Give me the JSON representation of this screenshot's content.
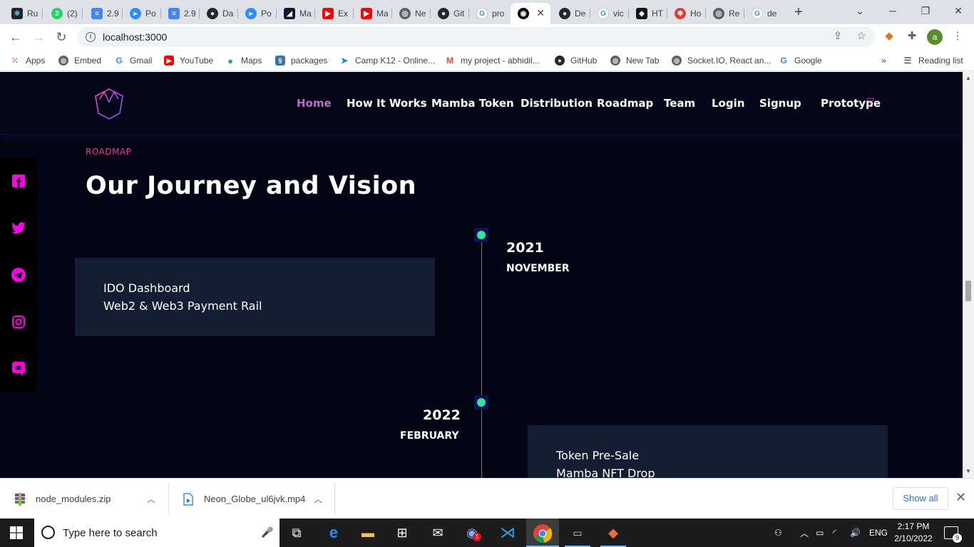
{
  "browser": {
    "tabs": [
      {
        "label": "Ru",
        "icon": "react-icon",
        "color": "#20232a"
      },
      {
        "label": "(2)",
        "icon": "whatsapp-icon",
        "color": "#25d366"
      },
      {
        "label": "2.9",
        "icon": "google-docs-icon",
        "color": "#4285f4"
      },
      {
        "label": "Po",
        "icon": "zoom-icon",
        "color": "#2d8cff"
      },
      {
        "label": "2.9",
        "icon": "google-docs-icon",
        "color": "#4285f4"
      },
      {
        "label": "Da",
        "icon": "github-icon",
        "color": "#24292e"
      },
      {
        "label": "Po",
        "icon": "zoom-icon",
        "color": "#2d8cff"
      },
      {
        "label": "Ma",
        "icon": "app-icon",
        "color": "#0b1a33"
      },
      {
        "label": "Ex",
        "icon": "youtube-icon",
        "color": "#ff0000"
      },
      {
        "label": "Ma",
        "icon": "youtube-icon",
        "color": "#ff0000"
      },
      {
        "label": "Ne",
        "icon": "web-icon",
        "color": "#5f6368"
      },
      {
        "label": "Git",
        "icon": "github-icon",
        "color": "#24292e"
      },
      {
        "label": "pro",
        "icon": "google-icon",
        "color": "#4285f4"
      },
      {
        "label": "",
        "icon": "site-icon",
        "color": "#000000",
        "active": true
      },
      {
        "label": "De",
        "icon": "github-icon",
        "color": "#24292e"
      },
      {
        "label": "vic",
        "icon": "google-icon",
        "color": "#4285f4"
      },
      {
        "label": "HT",
        "icon": "codesandbox-icon",
        "color": "#151515"
      },
      {
        "label": "Ho",
        "icon": "gear-red-icon",
        "color": "#e53935"
      },
      {
        "label": "Re",
        "icon": "web-icon",
        "color": "#5f6368"
      },
      {
        "label": "de",
        "icon": "google-icon",
        "color": "#4285f4"
      }
    ],
    "url": "localhost:3000",
    "profile_initial": "a"
  },
  "bookmarks": [
    {
      "label": "Apps",
      "icon": "apps-grid-icon",
      "color": "#ea4335"
    },
    {
      "label": "Embed",
      "icon": "web-icon",
      "color": "#5f6368"
    },
    {
      "label": "Gmail",
      "icon": "google-icon",
      "color": "#4285f4"
    },
    {
      "label": "YouTube",
      "icon": "youtube-icon",
      "color": "#ff0000"
    },
    {
      "label": "Maps",
      "icon": "maps-pin-icon",
      "color": "#34a853"
    },
    {
      "label": "packages",
      "icon": "python-icon",
      "color": "#3776ab"
    },
    {
      "label": "Camp K12 - Online...",
      "icon": "campk12-icon",
      "color": "#1e88e5"
    },
    {
      "label": "my project - abhidil...",
      "icon": "gmail-icon",
      "color": "#ea4335"
    },
    {
      "label": "GitHub",
      "icon": "github-icon",
      "color": "#24292e"
    },
    {
      "label": "New Tab",
      "icon": "web-icon",
      "color": "#5f6368"
    },
    {
      "label": "Socket.IO, React an...",
      "icon": "web-icon",
      "color": "#5f6368"
    },
    {
      "label": "Google",
      "icon": "google-icon",
      "color": "#4285f4"
    }
  ],
  "reading_list": "Reading list",
  "site": {
    "nav": [
      "Home",
      "How It Works",
      "Mamba Token",
      "Distribution",
      "Roadmap",
      "Team",
      "Login",
      "Signup",
      "Prototype"
    ],
    "active_nav": "Home",
    "section_label": "ROADMAP",
    "headline": "Our Journey and Vision",
    "social": [
      "facebook-icon",
      "twitter-icon",
      "telegram-icon",
      "instagram-icon",
      "discord-icon"
    ],
    "timeline": [
      {
        "year": "2021",
        "month": "NOVEMBER",
        "items": [
          "IDO Dashboard",
          "Web2 & Web3 Payment Rail"
        ]
      },
      {
        "year": "2022",
        "month": "FEBRUARY",
        "items": [
          "Token Pre-Sale",
          "Mamba NFT Drop"
        ]
      }
    ],
    "accent": "#ff00e6",
    "timeline_dot": "#2ee59a"
  },
  "downloads": [
    {
      "name": "node_modules.zip",
      "icon": "winrar-icon"
    },
    {
      "name": "Neon_Globe_ul6jvk.mp4",
      "icon": "video-file-icon"
    }
  ],
  "show_all": "Show all",
  "taskbar": {
    "search_placeholder": "Type here to search",
    "language": "ENG",
    "time": "2:17 PM",
    "date": "2/10/2022",
    "notification_count": "9",
    "badge_count": "1"
  }
}
